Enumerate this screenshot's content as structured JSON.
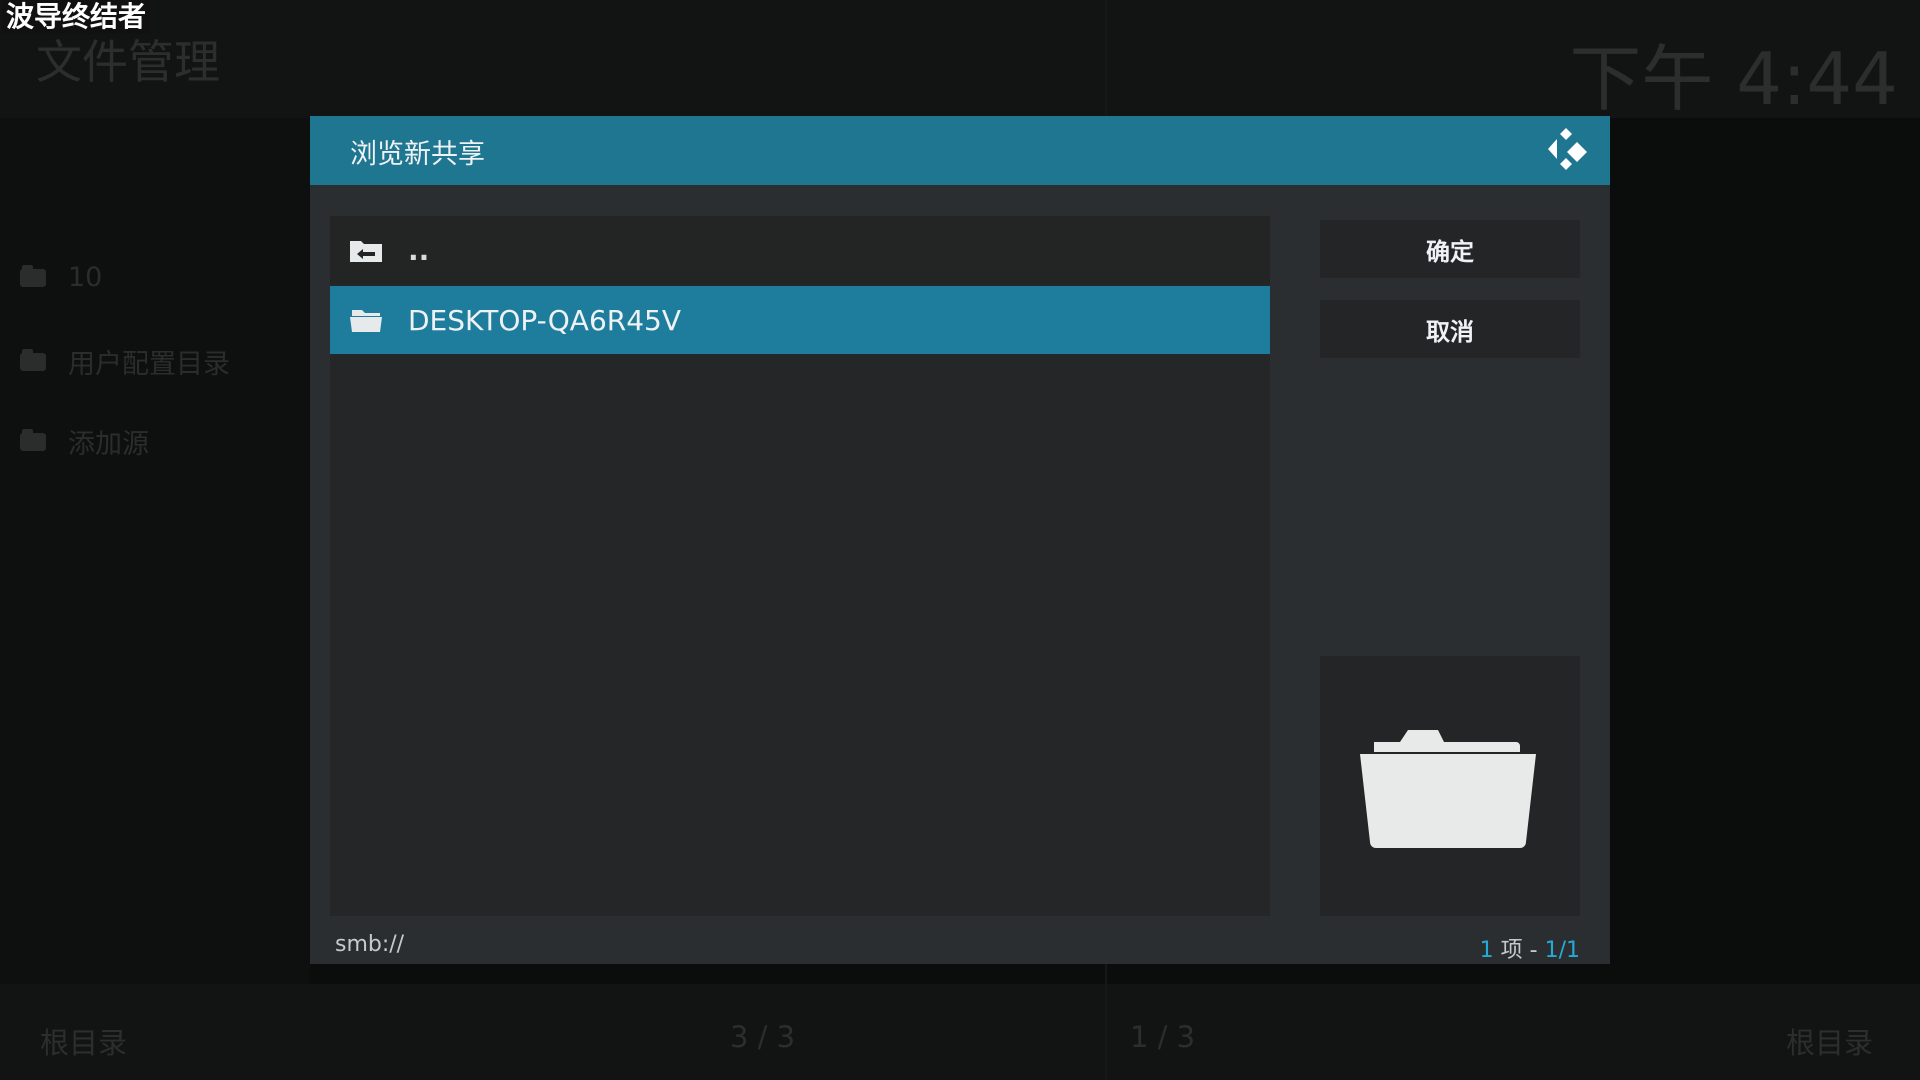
{
  "watermark": "波导终结者",
  "background": {
    "title": "文件管理",
    "clock": "下午 4:44",
    "items": [
      "10",
      "用户配置目录",
      "添加源"
    ],
    "footer": {
      "left_label": "根目录",
      "left_count": "3 / 3",
      "right_count": "1 / 3",
      "right_label": "根目录"
    }
  },
  "dialog": {
    "title": "浏览新共享",
    "logo_icon": "kodi-logo-icon",
    "list": {
      "parent_label": "..",
      "items": [
        {
          "label": "DESKTOP-QA6R45V",
          "icon": "folder-icon",
          "selected": true
        }
      ]
    },
    "buttons": {
      "ok": "确定",
      "cancel": "取消"
    },
    "thumbnail_icon": "folder-open-icon",
    "path": "smb://",
    "count": {
      "items": "1",
      "unit": " 项 - ",
      "page": "1/1"
    }
  },
  "colors": {
    "header": "#1f7690",
    "selected": "#1e7d9c",
    "accent": "#27a9d6"
  }
}
